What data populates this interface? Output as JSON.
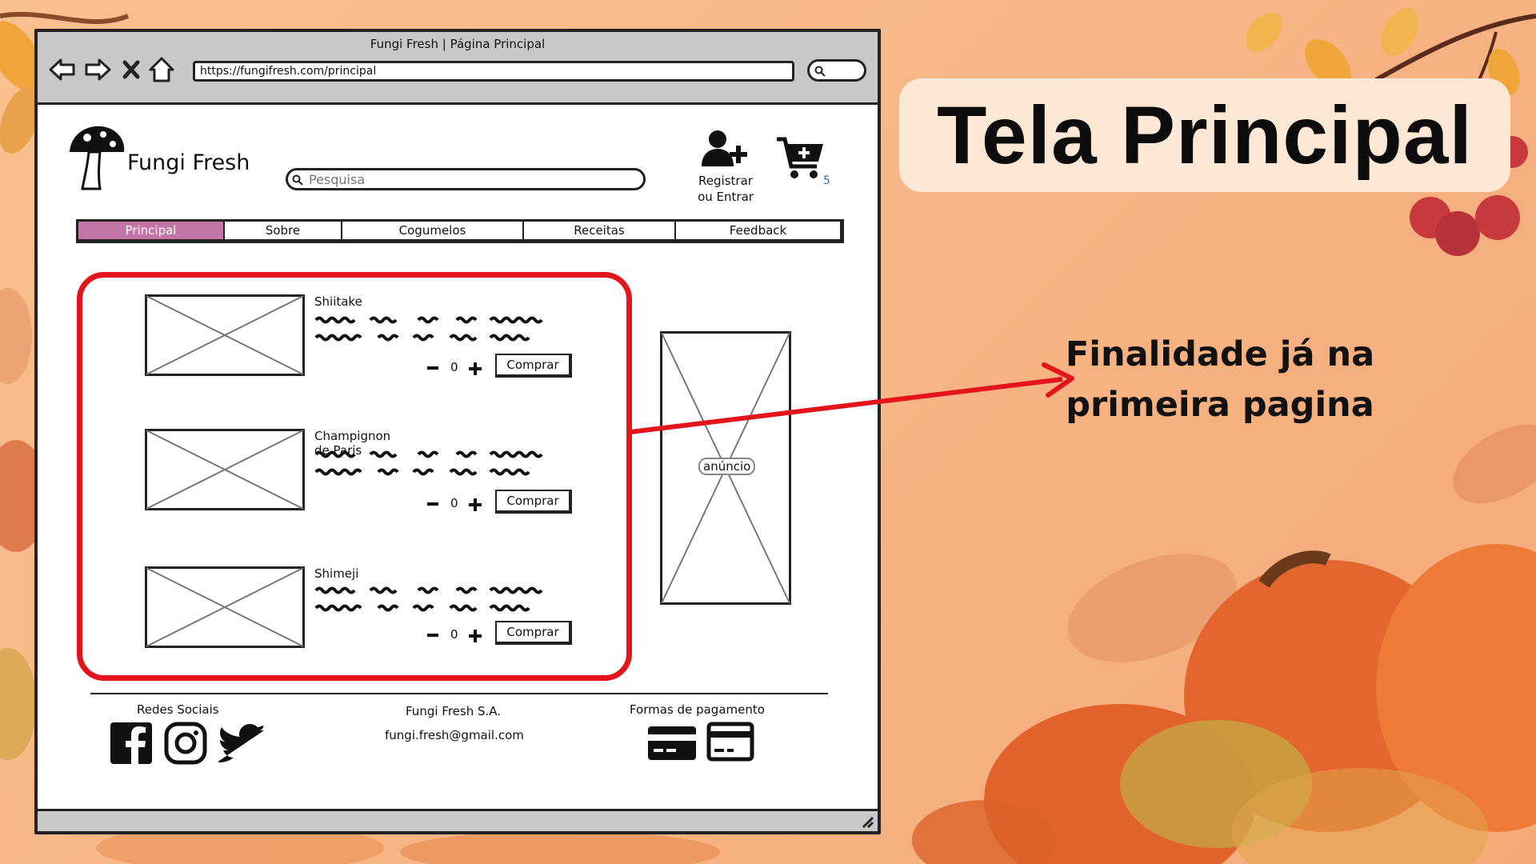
{
  "slide": {
    "title": "Tela Principal",
    "annotation_line1": "Finalidade já na",
    "annotation_line2": "primeira pagina"
  },
  "browser": {
    "title": "Fungi Fresh | Página Principal",
    "url": "https://fungifresh.com/principal",
    "nav_icons": [
      "back-arrow-icon",
      "forward-arrow-icon",
      "close-x-icon",
      "home-icon"
    ]
  },
  "header": {
    "brand": "Fungi Fresh",
    "search_placeholder": "Pesquisa",
    "account_line1": "Registrar",
    "account_line2": "ou Entrar",
    "cart_count": "5"
  },
  "nav": {
    "tabs": [
      {
        "label": "Principal",
        "active": true
      },
      {
        "label": "Sobre",
        "active": false
      },
      {
        "label": "Cogumelos",
        "active": false
      },
      {
        "label": "Receitas",
        "active": false
      },
      {
        "label": "Feedback",
        "active": false
      }
    ]
  },
  "products": [
    {
      "name": "Shiitake",
      "qty": "0",
      "buy_label": "Comprar"
    },
    {
      "name": "Champignon de Paris",
      "qty": "0",
      "buy_label": "Comprar"
    },
    {
      "name": "Shimeji",
      "qty": "0",
      "buy_label": "Comprar"
    }
  ],
  "ad": {
    "label": "anúncio"
  },
  "footer": {
    "social_title": "Redes Sociais",
    "social_icons": [
      "facebook-icon",
      "instagram-icon",
      "twitter-icon"
    ],
    "company": "Fungi Fresh S.A.",
    "email": "fungi.fresh@gmail.com",
    "payment_title": "Formas de pagamento",
    "payment_icons": [
      "credit-card-icon",
      "debit-card-icon"
    ]
  },
  "colors": {
    "background": "#f7b686",
    "highlight_red": "#e3141c",
    "active_tab": "#c276a6",
    "title_card": "#fde8d5"
  }
}
